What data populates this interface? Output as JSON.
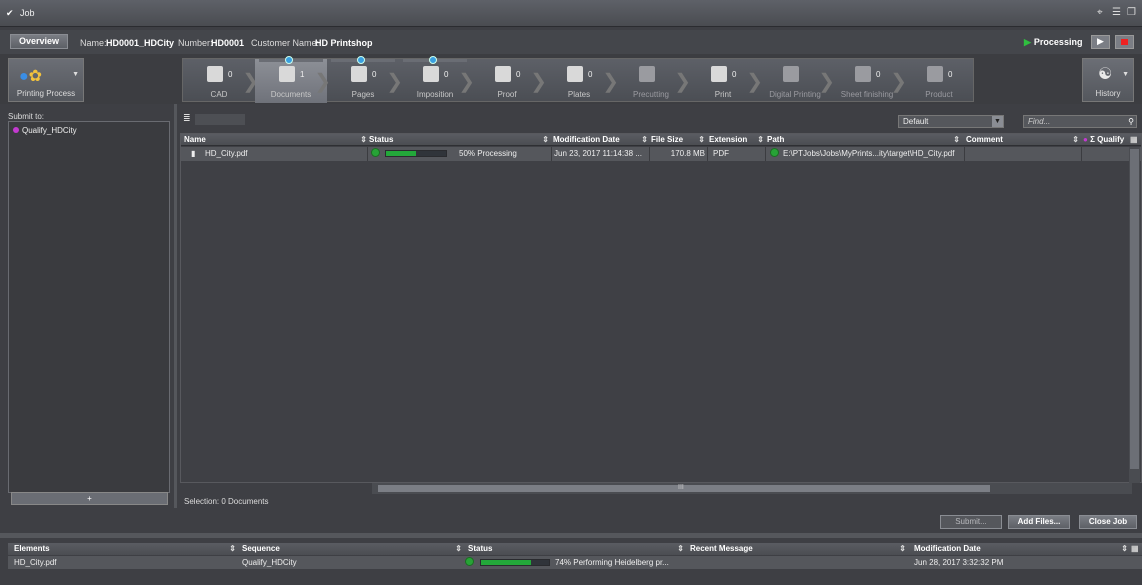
{
  "window": {
    "title": "Job"
  },
  "info": {
    "overview_label": "Overview",
    "name_label": "Name:",
    "name_value": "HD0001_HDCity",
    "number_label": "Number:",
    "number_value": "HD0001",
    "customer_label": "Customer Name:",
    "customer_value": "HD Printshop",
    "status": "Processing"
  },
  "printing_process": {
    "label": "Printing Process"
  },
  "history": {
    "label": "History"
  },
  "steps": [
    {
      "label": "CAD",
      "count": "0"
    },
    {
      "label": "Documents",
      "count": "1"
    },
    {
      "label": "Pages",
      "count": "0"
    },
    {
      "label": "Imposition",
      "count": "0"
    },
    {
      "label": "Proof",
      "count": "0"
    },
    {
      "label": "Plates",
      "count": "0"
    },
    {
      "label": "Precutting",
      "count": ""
    },
    {
      "label": "Print",
      "count": "0"
    },
    {
      "label": "Digital Printing",
      "count": ""
    },
    {
      "label": "Sheet finishing",
      "count": "0"
    },
    {
      "label": "Product",
      "count": "0"
    }
  ],
  "left": {
    "submit_label": "Submit to:",
    "items": [
      "Qualify_HDCity"
    ],
    "add_label": "+"
  },
  "toolbar": {
    "view_select": "Default",
    "find_placeholder": "Find..."
  },
  "table": {
    "columns": [
      "Name",
      "Status",
      "Modification Date",
      "File Size",
      "Extension",
      "Path",
      "Comment",
      "Σ Qualify"
    ],
    "rows": [
      {
        "name": "HD_City.pdf",
        "status_text": "50%  Processing",
        "progress": 0.5,
        "mod_date": "Jun 23, 2017 11:14:38 ...",
        "size": "170.8 MB",
        "ext": "PDF",
        "path": "E:\\PTJobs\\Jobs\\MyPrints...ity\\target\\HD_City.pdf",
        "comment": "",
        "qualify": ""
      }
    ],
    "hscroll_mid": "III"
  },
  "selection": "Selection:  0 Documents",
  "buttons": {
    "submit": "Submit...",
    "add_files": "Add Files...",
    "close_job": "Close Job"
  },
  "bottom": {
    "columns": [
      "Elements",
      "Sequence",
      "Status",
      "Recent Message",
      "Modification Date"
    ],
    "rows": [
      {
        "element": "HD_City.pdf",
        "sequence": "Qualify_HDCity",
        "progress": 0.74,
        "status_text": "74%  Performing Heidelberg pr...",
        "message": "",
        "mod_date": "Jun 28, 2017 3:32:32 PM"
      }
    ]
  },
  "colors": {
    "accent_green": "#23a83a",
    "background": "#3e3f44",
    "qualify_dot": "#c33ad0"
  }
}
